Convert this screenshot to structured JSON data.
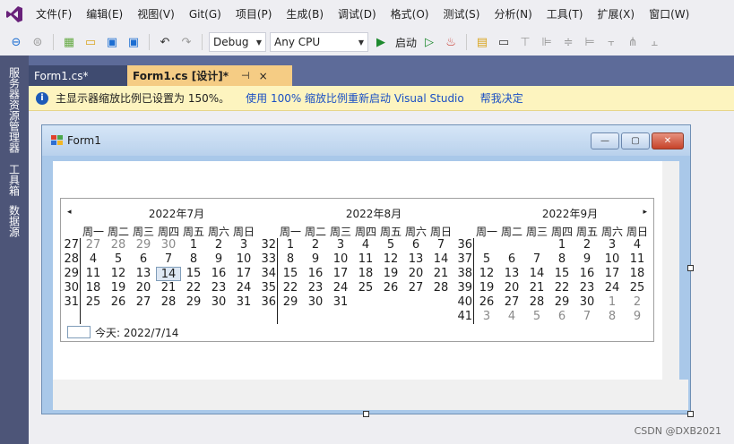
{
  "menu": [
    "文件(F)",
    "编辑(E)",
    "视图(V)",
    "Git(G)",
    "项目(P)",
    "生成(B)",
    "调试(D)",
    "格式(O)",
    "测试(S)",
    "分析(N)",
    "工具(T)",
    "扩展(X)",
    "窗口(W)"
  ],
  "toolbar": {
    "config": "Debug",
    "platform": "Any CPU",
    "run_label": "启动"
  },
  "side_tabs": [
    "服务器资源管理器",
    "工具箱",
    "数据源"
  ],
  "tabs": {
    "inactive": "Form1.cs*",
    "active": "Form1.cs [设计]*",
    "pin": "⊣",
    "close": "×"
  },
  "infobar": {
    "message": "主显示器缩放比例已设置为 150%。",
    "link1": "使用 100% 缩放比例重新启动 Visual Studio",
    "link2": "帮我决定"
  },
  "form": {
    "title": "Form1"
  },
  "calendar": {
    "prev": "◂",
    "next": "▸",
    "weekdays": [
      "周一",
      "周二",
      "周三",
      "周四",
      "周五",
      "周六",
      "周日"
    ],
    "months": [
      {
        "title": "2022年7月",
        "weeks": [
          "27",
          "28",
          "29",
          "30",
          "31"
        ],
        "rows": [
          [
            "27",
            "28",
            "29",
            "30",
            "1",
            "2",
            "3"
          ],
          [
            "4",
            "5",
            "6",
            "7",
            "8",
            "9",
            "10"
          ],
          [
            "11",
            "12",
            "13",
            "14",
            "15",
            "16",
            "17"
          ],
          [
            "18",
            "19",
            "20",
            "21",
            "22",
            "23",
            "24"
          ],
          [
            "25",
            "26",
            "27",
            "28",
            "29",
            "30",
            "31"
          ]
        ],
        "trailing": [
          [
            1,
            2,
            3
          ]
        ],
        "today": [
          2,
          3
        ]
      },
      {
        "title": "2022年8月",
        "weeks": [
          "32",
          "33",
          "34",
          "35",
          "36"
        ],
        "rows": [
          [
            "1",
            "2",
            "3",
            "4",
            "5",
            "6",
            "7"
          ],
          [
            "8",
            "9",
            "10",
            "11",
            "12",
            "13",
            "14"
          ],
          [
            "15",
            "16",
            "17",
            "18",
            "19",
            "20",
            "21"
          ],
          [
            "22",
            "23",
            "24",
            "25",
            "26",
            "27",
            "28"
          ],
          [
            "29",
            "30",
            "31",
            "",
            "",
            "",
            ""
          ]
        ]
      },
      {
        "title": "2022年9月",
        "weeks": [
          "36",
          "37",
          "38",
          "39",
          "40",
          "41"
        ],
        "rows": [
          [
            "",
            "",
            "",
            "1",
            "2",
            "3",
            "4"
          ],
          [
            "5",
            "6",
            "7",
            "8",
            "9",
            "10",
            "11"
          ],
          [
            "12",
            "13",
            "14",
            "15",
            "16",
            "17",
            "18"
          ],
          [
            "19",
            "20",
            "21",
            "22",
            "23",
            "24",
            "25"
          ],
          [
            "26",
            "27",
            "28",
            "29",
            "30",
            "1",
            "2"
          ],
          [
            "3",
            "4",
            "5",
            "6",
            "7",
            "8",
            "9"
          ]
        ]
      }
    ],
    "today_label": "今天: 2022/7/14"
  },
  "watermark": "CSDN @DXB2021",
  "colors": {
    "tab_active": "#f5cc84",
    "doc_strip": "#5d6b99",
    "infobar": "#fdf4bf",
    "link": "#1a4fc4"
  }
}
